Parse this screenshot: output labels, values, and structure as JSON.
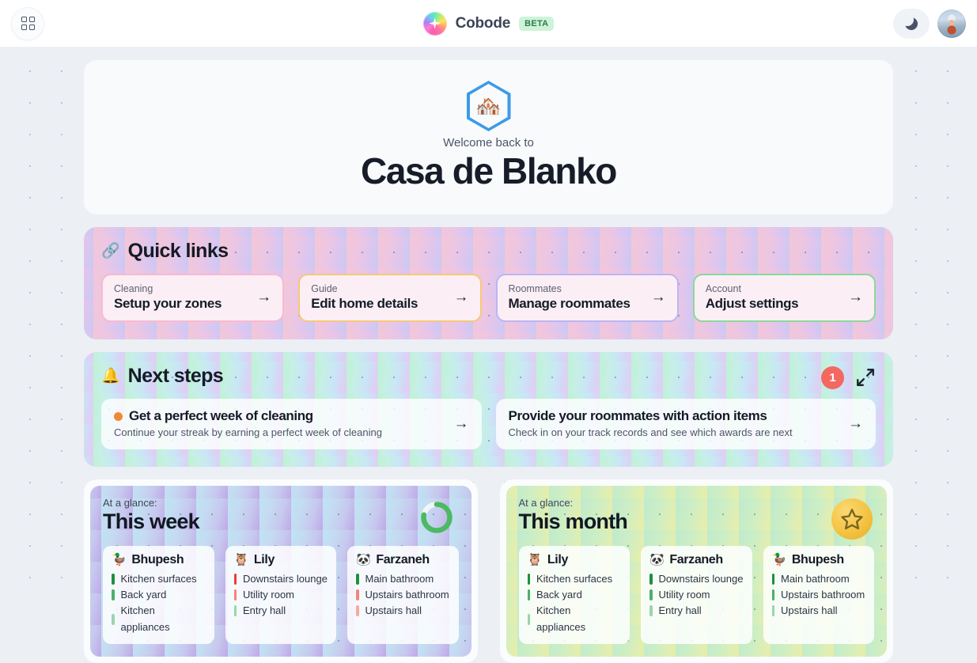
{
  "topbar": {
    "grid_icon": "grid-menu-icon",
    "brand_name": "Cobode",
    "beta_label": "BETA",
    "theme_icon": "moon-icon",
    "avatar_label": "user-avatar"
  },
  "hero": {
    "emoji": "🏘️",
    "subtitle": "Welcome back to",
    "title": "Casa de Blanko"
  },
  "quick_links": {
    "emoji": "🔗",
    "title": "Quick links",
    "cards": [
      {
        "kicker": "Cleaning",
        "label": "Setup your zones",
        "arrow": "→",
        "border": "#f9b9cf"
      },
      {
        "kicker": "Guide",
        "label": "Edit home details",
        "arrow": "→",
        "border": "#f6c878"
      },
      {
        "kicker": "Roommates",
        "label": "Manage roommates",
        "arrow": "→",
        "border": "#bdb4f2"
      },
      {
        "kicker": "Account",
        "label": "Adjust settings",
        "arrow": "→",
        "border": "#8cd89a"
      }
    ]
  },
  "next_steps": {
    "emoji": "🔔",
    "title": "Next steps",
    "badge_count": "1",
    "expand_icon": "expand-diagonal-icon",
    "cards": [
      {
        "title": "Get a perfect week of cleaning",
        "desc": "Continue your streak by earning a perfect week of cleaning",
        "arrow": "→",
        "dot_color": "#f08a32",
        "has_dot": true
      },
      {
        "title": "Provide your roommates with action items",
        "desc": "Check in on your track records and see which awards are next",
        "arrow": "→",
        "has_dot": false
      }
    ]
  },
  "glances": [
    {
      "kicker": "At a glance:",
      "title": "This week",
      "indicator": "progress-ring",
      "progress_percent": 78,
      "ring_color": "#4cb963",
      "people": [
        {
          "emoji": "🦆",
          "name": "Bhupesh",
          "tasks": [
            {
              "label": "Kitchen surfaces",
              "color": "#1f8f3d"
            },
            {
              "label": "Back yard",
              "color": "#4caf6a"
            },
            {
              "label": "Kitchen appliances",
              "color": "#9bd4ac"
            }
          ]
        },
        {
          "emoji": "🦉",
          "name": "Lily",
          "tasks": [
            {
              "label": "Downstairs lounge",
              "color": "#ef3b38"
            },
            {
              "label": "Utility room",
              "color": "#f58478"
            },
            {
              "label": "Entry hall",
              "color": "#9bd4ac"
            }
          ]
        },
        {
          "emoji": "🐼",
          "name": "Farzaneh",
          "tasks": [
            {
              "label": "Main bathroom",
              "color": "#1f8f3d"
            },
            {
              "label": "Upstairs bathroom",
              "color": "#f58478"
            },
            {
              "label": "Upstairs hall",
              "color": "#f8a9a0"
            }
          ]
        }
      ]
    },
    {
      "kicker": "At a glance:",
      "title": "This month",
      "indicator": "star-badge",
      "star_color": "#f4c342",
      "people": [
        {
          "emoji": "🦉",
          "name": "Lily",
          "tasks": [
            {
              "label": "Kitchen surfaces",
              "color": "#1f8f3d"
            },
            {
              "label": "Back yard",
              "color": "#4caf6a"
            },
            {
              "label": "Kitchen appliances",
              "color": "#9bd4ac"
            }
          ]
        },
        {
          "emoji": "🐼",
          "name": "Farzaneh",
          "tasks": [
            {
              "label": "Downstairs lounge",
              "color": "#1f8f3d"
            },
            {
              "label": "Utility room",
              "color": "#4caf6a"
            },
            {
              "label": "Entry hall",
              "color": "#9bd4ac"
            }
          ]
        },
        {
          "emoji": "🦆",
          "name": "Bhupesh",
          "tasks": [
            {
              "label": "Main bathroom",
              "color": "#1f8f3d"
            },
            {
              "label": "Upstairs bathroom",
              "color": "#4caf6a"
            },
            {
              "label": "Upstairs hall",
              "color": "#9bd4ac"
            }
          ]
        }
      ]
    }
  ]
}
